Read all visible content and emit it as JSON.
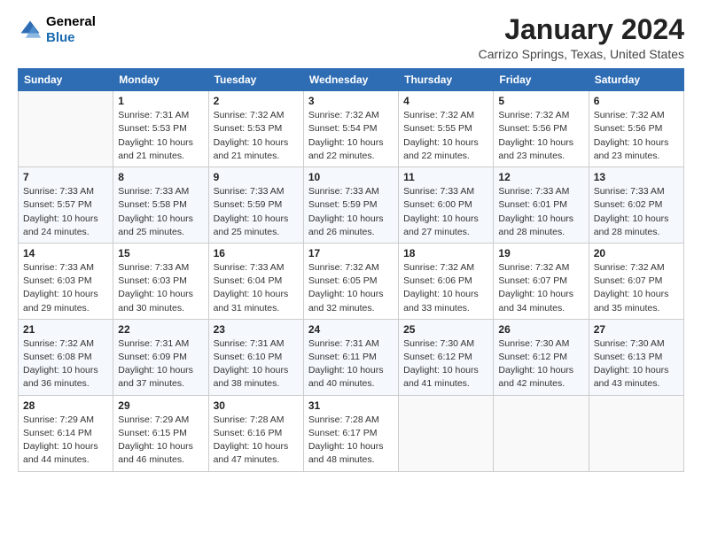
{
  "header": {
    "logo_line1": "General",
    "logo_line2": "Blue",
    "main_title": "January 2024",
    "sub_title": "Carrizo Springs, Texas, United States"
  },
  "calendar": {
    "days_of_week": [
      "Sunday",
      "Monday",
      "Tuesday",
      "Wednesday",
      "Thursday",
      "Friday",
      "Saturday"
    ],
    "weeks": [
      [
        {
          "day": "",
          "info": ""
        },
        {
          "day": "1",
          "info": "Sunrise: 7:31 AM\nSunset: 5:53 PM\nDaylight: 10 hours\nand 21 minutes."
        },
        {
          "day": "2",
          "info": "Sunrise: 7:32 AM\nSunset: 5:53 PM\nDaylight: 10 hours\nand 21 minutes."
        },
        {
          "day": "3",
          "info": "Sunrise: 7:32 AM\nSunset: 5:54 PM\nDaylight: 10 hours\nand 22 minutes."
        },
        {
          "day": "4",
          "info": "Sunrise: 7:32 AM\nSunset: 5:55 PM\nDaylight: 10 hours\nand 22 minutes."
        },
        {
          "day": "5",
          "info": "Sunrise: 7:32 AM\nSunset: 5:56 PM\nDaylight: 10 hours\nand 23 minutes."
        },
        {
          "day": "6",
          "info": "Sunrise: 7:32 AM\nSunset: 5:56 PM\nDaylight: 10 hours\nand 23 minutes."
        }
      ],
      [
        {
          "day": "7",
          "info": "Sunrise: 7:33 AM\nSunset: 5:57 PM\nDaylight: 10 hours\nand 24 minutes."
        },
        {
          "day": "8",
          "info": "Sunrise: 7:33 AM\nSunset: 5:58 PM\nDaylight: 10 hours\nand 25 minutes."
        },
        {
          "day": "9",
          "info": "Sunrise: 7:33 AM\nSunset: 5:59 PM\nDaylight: 10 hours\nand 25 minutes."
        },
        {
          "day": "10",
          "info": "Sunrise: 7:33 AM\nSunset: 5:59 PM\nDaylight: 10 hours\nand 26 minutes."
        },
        {
          "day": "11",
          "info": "Sunrise: 7:33 AM\nSunset: 6:00 PM\nDaylight: 10 hours\nand 27 minutes."
        },
        {
          "day": "12",
          "info": "Sunrise: 7:33 AM\nSunset: 6:01 PM\nDaylight: 10 hours\nand 28 minutes."
        },
        {
          "day": "13",
          "info": "Sunrise: 7:33 AM\nSunset: 6:02 PM\nDaylight: 10 hours\nand 28 minutes."
        }
      ],
      [
        {
          "day": "14",
          "info": "Sunrise: 7:33 AM\nSunset: 6:03 PM\nDaylight: 10 hours\nand 29 minutes."
        },
        {
          "day": "15",
          "info": "Sunrise: 7:33 AM\nSunset: 6:03 PM\nDaylight: 10 hours\nand 30 minutes."
        },
        {
          "day": "16",
          "info": "Sunrise: 7:33 AM\nSunset: 6:04 PM\nDaylight: 10 hours\nand 31 minutes."
        },
        {
          "day": "17",
          "info": "Sunrise: 7:32 AM\nSunset: 6:05 PM\nDaylight: 10 hours\nand 32 minutes."
        },
        {
          "day": "18",
          "info": "Sunrise: 7:32 AM\nSunset: 6:06 PM\nDaylight: 10 hours\nand 33 minutes."
        },
        {
          "day": "19",
          "info": "Sunrise: 7:32 AM\nSunset: 6:07 PM\nDaylight: 10 hours\nand 34 minutes."
        },
        {
          "day": "20",
          "info": "Sunrise: 7:32 AM\nSunset: 6:07 PM\nDaylight: 10 hours\nand 35 minutes."
        }
      ],
      [
        {
          "day": "21",
          "info": "Sunrise: 7:32 AM\nSunset: 6:08 PM\nDaylight: 10 hours\nand 36 minutes."
        },
        {
          "day": "22",
          "info": "Sunrise: 7:31 AM\nSunset: 6:09 PM\nDaylight: 10 hours\nand 37 minutes."
        },
        {
          "day": "23",
          "info": "Sunrise: 7:31 AM\nSunset: 6:10 PM\nDaylight: 10 hours\nand 38 minutes."
        },
        {
          "day": "24",
          "info": "Sunrise: 7:31 AM\nSunset: 6:11 PM\nDaylight: 10 hours\nand 40 minutes."
        },
        {
          "day": "25",
          "info": "Sunrise: 7:30 AM\nSunset: 6:12 PM\nDaylight: 10 hours\nand 41 minutes."
        },
        {
          "day": "26",
          "info": "Sunrise: 7:30 AM\nSunset: 6:12 PM\nDaylight: 10 hours\nand 42 minutes."
        },
        {
          "day": "27",
          "info": "Sunrise: 7:30 AM\nSunset: 6:13 PM\nDaylight: 10 hours\nand 43 minutes."
        }
      ],
      [
        {
          "day": "28",
          "info": "Sunrise: 7:29 AM\nSunset: 6:14 PM\nDaylight: 10 hours\nand 44 minutes."
        },
        {
          "day": "29",
          "info": "Sunrise: 7:29 AM\nSunset: 6:15 PM\nDaylight: 10 hours\nand 46 minutes."
        },
        {
          "day": "30",
          "info": "Sunrise: 7:28 AM\nSunset: 6:16 PM\nDaylight: 10 hours\nand 47 minutes."
        },
        {
          "day": "31",
          "info": "Sunrise: 7:28 AM\nSunset: 6:17 PM\nDaylight: 10 hours\nand 48 minutes."
        },
        {
          "day": "",
          "info": ""
        },
        {
          "day": "",
          "info": ""
        },
        {
          "day": "",
          "info": ""
        }
      ]
    ]
  }
}
